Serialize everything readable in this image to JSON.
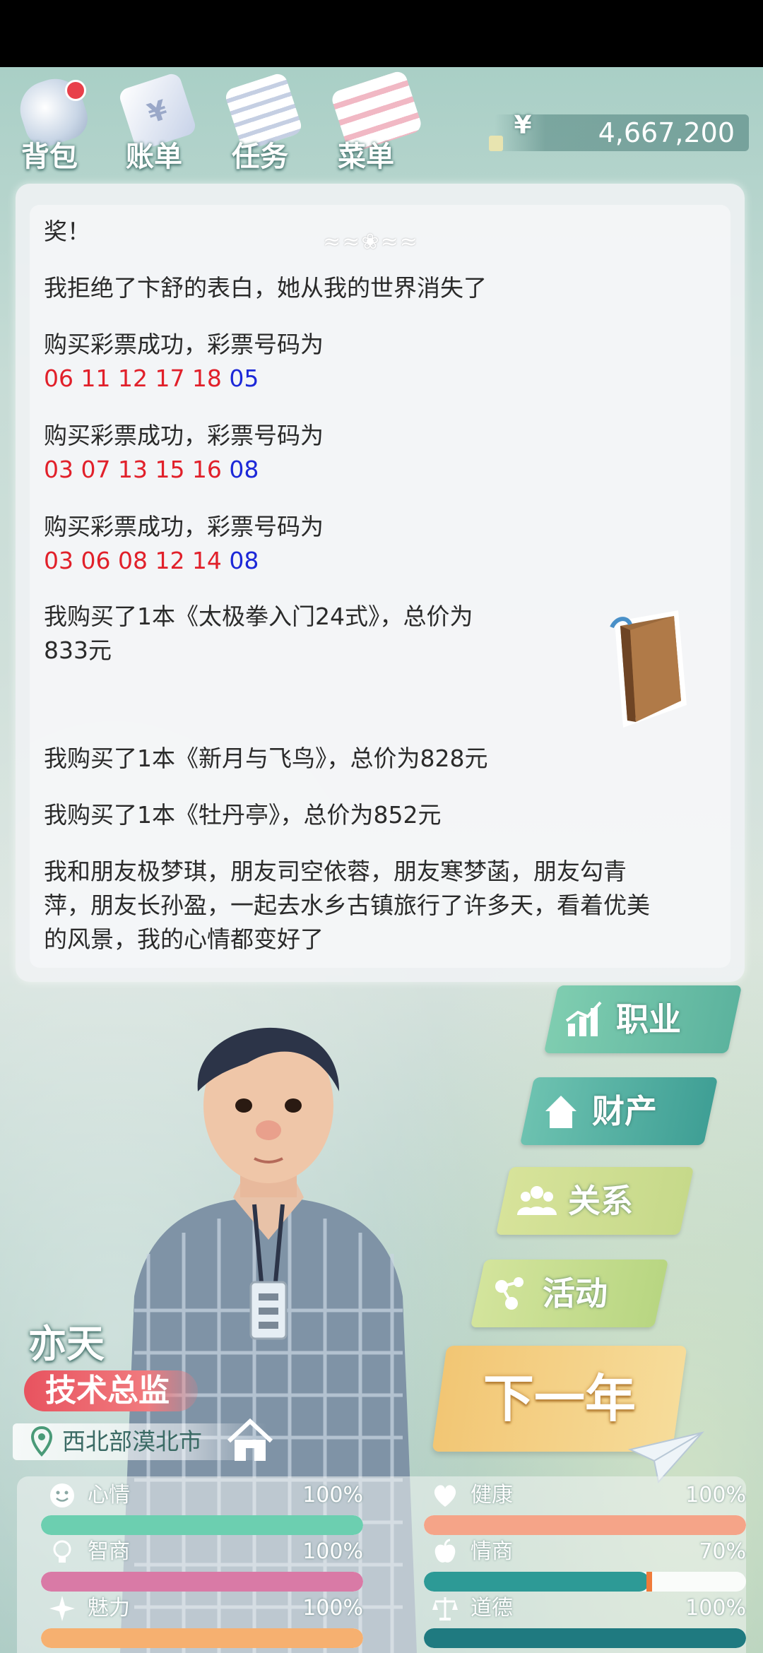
{
  "toolbar": {
    "items": [
      {
        "label": "背包",
        "badge": true
      },
      {
        "label": "账单",
        "badge": false
      },
      {
        "label": "任务",
        "badge": false
      },
      {
        "label": "菜单",
        "badge": false
      }
    ],
    "currency_symbol": "¥",
    "money": "4,667,200"
  },
  "log": {
    "ornament": "≈≈❀≈≈",
    "entries": [
      {
        "text": "奖！"
      },
      {
        "text": "我拒绝了卞舒的表白，她从我的世界消失了"
      },
      {
        "text": "购买彩票成功，彩票号码为",
        "red": "06 11 12 17 18",
        "blue": "05"
      },
      {
        "text": "购买彩票成功，彩票号码为",
        "red": "03 07 13 15 16",
        "blue": "08"
      },
      {
        "text": "购买彩票成功，彩票号码为",
        "red": "03 06 08 12 14",
        "blue": "08"
      },
      {
        "text": "我购买了1本《太极拳入门24式》，总价为",
        "text2": "833元"
      },
      {
        "text": "我购买了1本《新月与飞鸟》，总价为828元"
      },
      {
        "text": "我购买了1本《牡丹亭》，总价为852元"
      },
      {
        "text": "我和朋友极梦琪，朋友司空依蓉，朋友寒梦菡，朋友勾青",
        "text2": "萍，朋友长孙盈，一起去水乡古镇旅行了许多天，看着优美",
        "text3": "的风景，我的心情都变好了"
      }
    ]
  },
  "menu": {
    "career": "职业",
    "assets": "财产",
    "relations": "关系",
    "activities": "活动",
    "next_year": "下一年"
  },
  "character": {
    "name": "亦天",
    "title": "技术总监",
    "location": "西北部漠北市"
  },
  "stats": [
    {
      "name": "心情",
      "value": "100%",
      "level": 1.0,
      "icon": "smile-icon",
      "color": "#6ccfb0"
    },
    {
      "name": "健康",
      "value": "100%",
      "level": 1.0,
      "icon": "heart-icon",
      "color": "#f5a488"
    },
    {
      "name": "智商",
      "value": "100%",
      "level": 1.0,
      "icon": "bulb-icon",
      "color": "#d97aa6"
    },
    {
      "name": "情商",
      "value": "70%",
      "level": 0.7,
      "icon": "apple-icon",
      "color": "#2d9a96"
    },
    {
      "name": "魅力",
      "value": "100%",
      "level": 1.0,
      "icon": "star-icon",
      "color": "#f6b070"
    },
    {
      "name": "道德",
      "value": "100%",
      "level": 1.0,
      "icon": "scale-icon",
      "color": "#1f7a80"
    }
  ],
  "colors": {
    "lottery_red": "#e1202a",
    "lottery_blue": "#1c28d8",
    "title_badge": "#e8535f",
    "next_year_bg": "#f2c674"
  }
}
